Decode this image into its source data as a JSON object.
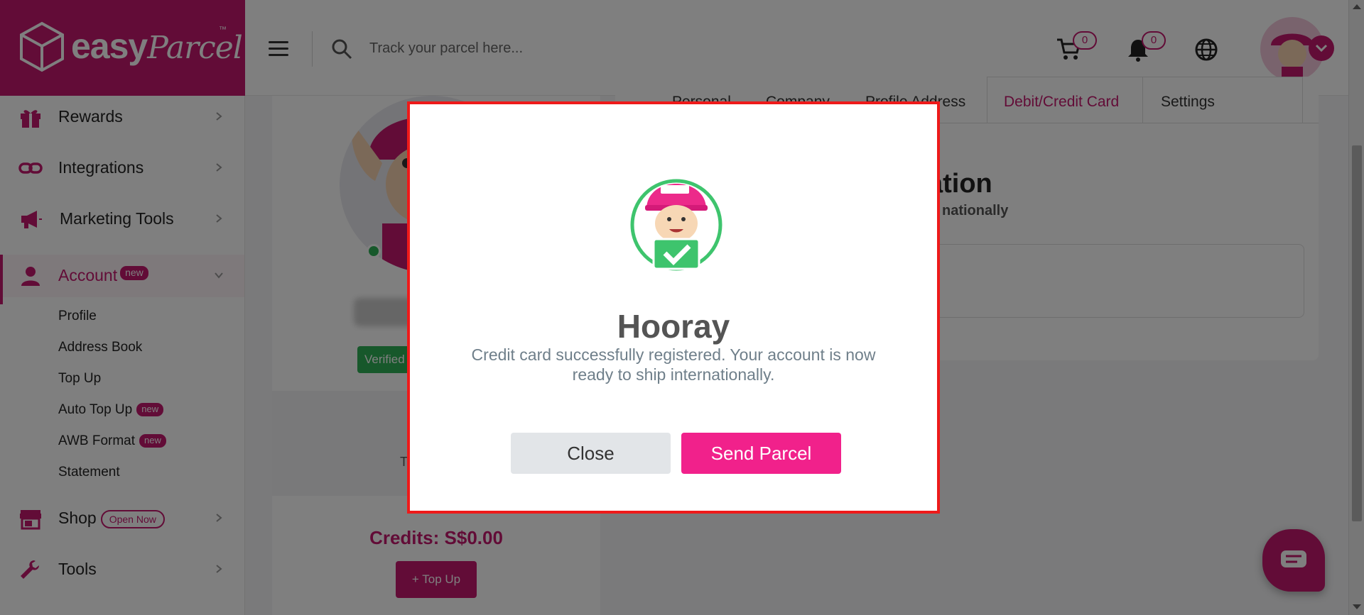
{
  "header": {
    "logo_text": "easy",
    "logo_script": "Parcel",
    "logo_tm": "™",
    "search_placeholder": "Track your parcel here...",
    "cart_count": "0",
    "notification_count": "0"
  },
  "sidebar": {
    "items": [
      {
        "label": "Rewards",
        "icon": "gift-icon"
      },
      {
        "label": "Integrations",
        "icon": "link-icon"
      },
      {
        "label": "Marketing Tools",
        "icon": "megaphone-icon"
      },
      {
        "label": "Account",
        "icon": "person-icon",
        "badge": "new"
      },
      {
        "label": "Shop",
        "icon": "store-icon",
        "badge": "Open Now"
      },
      {
        "label": "Tools",
        "icon": "wrench-icon"
      }
    ],
    "account_sub": [
      {
        "label": "Profile"
      },
      {
        "label": "Address Book"
      },
      {
        "label": "Top Up"
      },
      {
        "label": "Auto Top Up",
        "badge": "new"
      },
      {
        "label": "AWB Format",
        "badge": "new"
      },
      {
        "label": "Statement"
      }
    ]
  },
  "profile": {
    "verified_label": "Verified",
    "mid_text": "T",
    "credits": "Credits: S$0.00",
    "topup_label": "Top Up"
  },
  "tabs": {
    "items": [
      "Personal",
      "Company",
      "Profile Address",
      "Debit/Credit Card",
      "Settings"
    ],
    "active": "Debit/Credit Card",
    "title_fragment": "ation",
    "subtitle_fragment": "nationally"
  },
  "modal": {
    "title": "Hooray",
    "message": "Credit card successfully registered. Your account is now ready to ship internationally.",
    "close_label": "Close",
    "send_label": "Send Parcel",
    "border_color": "#ee1a1a",
    "accent_color": "#f1218b"
  },
  "colors": {
    "brand": "#c5186e",
    "verified": "#2fb157"
  }
}
